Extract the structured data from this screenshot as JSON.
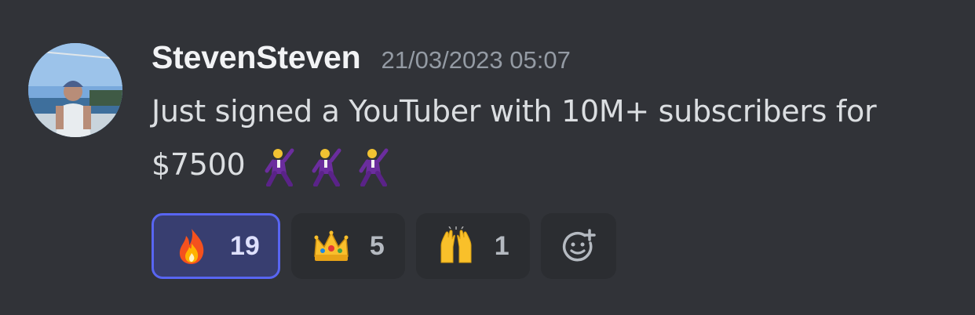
{
  "message": {
    "author": "StevenSteven",
    "timestamp": "21/03/2023 05:07",
    "text_line1": "Just signed a YouTuber with 10M+ subscribers for",
    "text_line2": "$7500",
    "inline_emojis": [
      "man-dancing-icon",
      "man-dancing-icon",
      "man-dancing-icon"
    ]
  },
  "reactions": [
    {
      "icon": "fire-icon",
      "count": "19",
      "active": true
    },
    {
      "icon": "crown-icon",
      "count": "5",
      "active": false
    },
    {
      "icon": "raising-hands-icon",
      "count": "1",
      "active": false
    }
  ],
  "add_reaction": {
    "icon": "add-reaction-icon"
  },
  "colors": {
    "background": "#313338",
    "reaction_bg": "#2b2d31",
    "active_reaction_bg": "#383e70",
    "active_reaction_border": "#5865f2"
  }
}
